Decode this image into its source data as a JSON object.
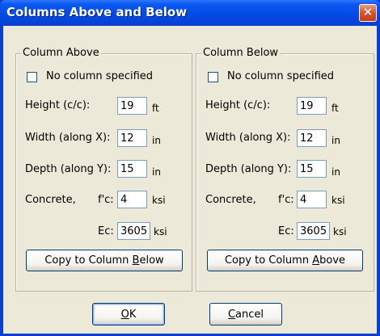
{
  "window": {
    "title": "Columns Above and Below",
    "close_symbol": "✕"
  },
  "above": {
    "group_label": "Column Above",
    "no_column_label": "No column specified",
    "no_column_checked": false,
    "height_label": "Height (c/c):",
    "height_value": "19",
    "height_unit": "ft",
    "width_label": "Width (along X):",
    "width_value": "12",
    "width_unit": "in",
    "depth_label": "Depth (along Y):",
    "depth_value": "15",
    "depth_unit": "in",
    "concrete_label": "Concrete,",
    "fc_label": "f'c:",
    "fc_value": "4",
    "fc_unit": "ksi",
    "ec_label": "Ec:",
    "ec_value": "3605",
    "ec_unit": "ksi",
    "copy_button": {
      "before": "Copy to Column ",
      "mnemonic": "B",
      "after": "elow"
    }
  },
  "below": {
    "group_label": "Column Below",
    "no_column_label": "No column specified",
    "no_column_checked": false,
    "height_label": "Height (c/c):",
    "height_value": "19",
    "height_unit": "ft",
    "width_label": "Width (along X):",
    "width_value": "12",
    "width_unit": "in",
    "depth_label": "Depth (along Y):",
    "depth_value": "15",
    "depth_unit": "in",
    "concrete_label": "Concrete,",
    "fc_label": "f'c:",
    "fc_value": "4",
    "fc_unit": "ksi",
    "ec_label": "Ec:",
    "ec_value": "3605",
    "ec_unit": "ksi",
    "copy_button": {
      "before": "Copy to Column ",
      "mnemonic": "A",
      "after": "bove"
    }
  },
  "buttons": {
    "ok": {
      "mnemonic": "O",
      "after": "K"
    },
    "cancel": {
      "mnemonic": "C",
      "after": "ancel"
    }
  },
  "colors": {
    "title_bar": "#0a3fd0",
    "dialog_face": "#ece9d8",
    "close_button": "#d9522e"
  }
}
